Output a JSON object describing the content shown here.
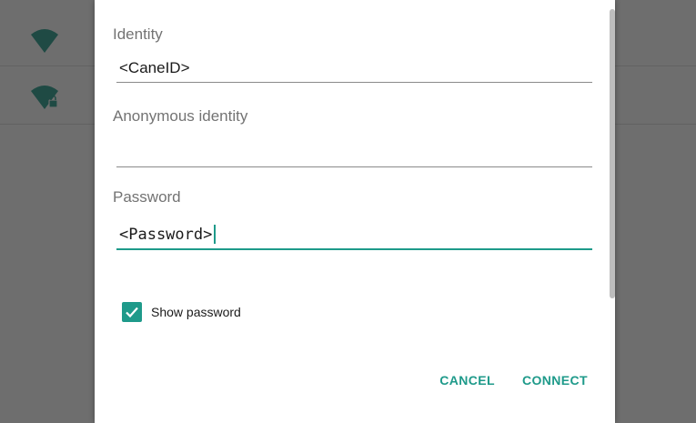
{
  "dialog": {
    "identity": {
      "label": "Identity",
      "value": "<CaneID>"
    },
    "anonymous_identity": {
      "label": "Anonymous identity",
      "value": ""
    },
    "password": {
      "label": "Password",
      "value": "<Password>"
    },
    "show_password": {
      "label": "Show password",
      "checked": true
    },
    "actions": {
      "cancel": "CANCEL",
      "connect": "CONNECT"
    }
  },
  "background_list": {
    "icons": [
      "wifi-signal-icon",
      "wifi-signal-locked-icon"
    ]
  },
  "colors": {
    "accent": "#1e9a8a",
    "scrim": "#6e6e6e",
    "icon_dim": "#1f4a44"
  }
}
